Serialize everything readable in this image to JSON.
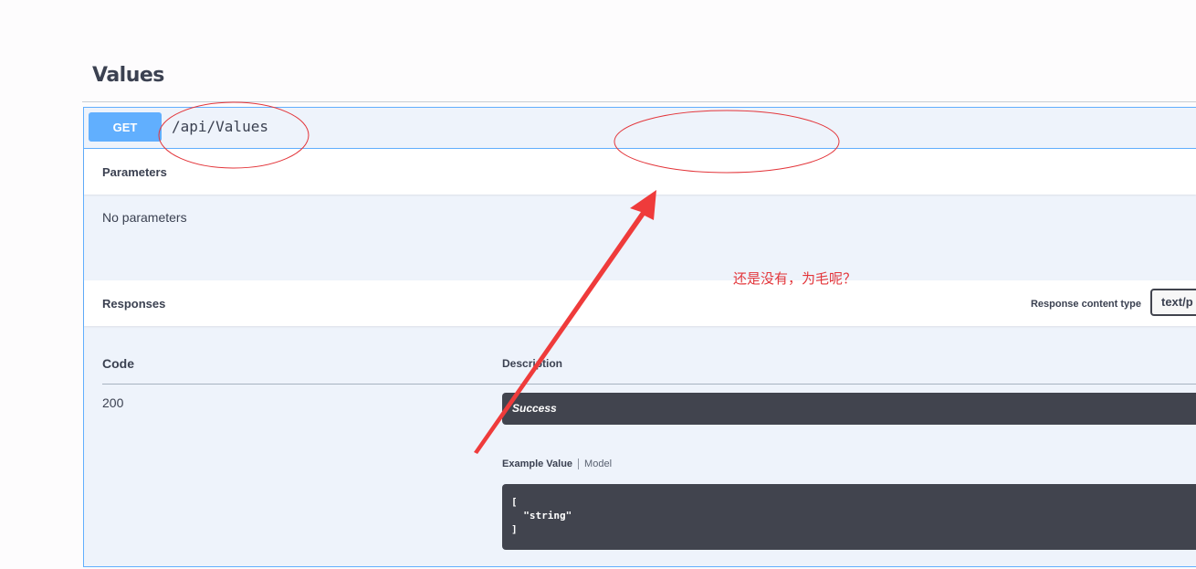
{
  "top_link": {
    "label": ""
  },
  "tag": {
    "title": "Values"
  },
  "operation": {
    "method": "GET",
    "path": "/api/Values",
    "method_color": "#61affe"
  },
  "parameters": {
    "title": "Parameters",
    "empty_text": "No parameters"
  },
  "responses": {
    "title": "Responses",
    "content_type_label": "Response content type",
    "content_type_value": "text/p",
    "columns": {
      "code": "Code",
      "description": "Description"
    },
    "rows": [
      {
        "code": "200",
        "description": "Success",
        "tabs": {
          "example": "Example Value",
          "model": "Model"
        },
        "example_value": "[\n  \"string\"\n]"
      }
    ]
  },
  "annotation": {
    "text": "还是没有，为毛呢？",
    "color": "#e3353a"
  }
}
